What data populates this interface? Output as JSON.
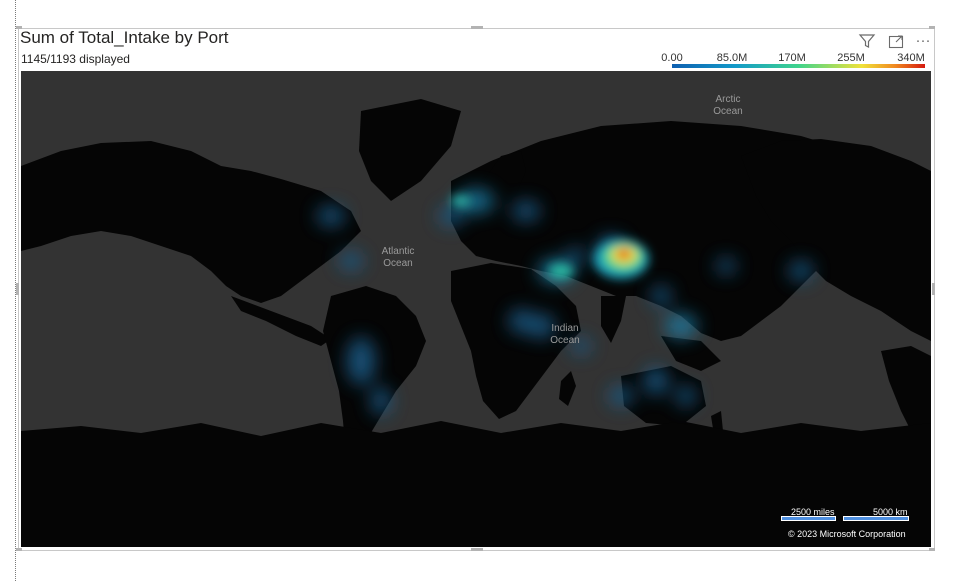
{
  "visual": {
    "title": "Sum of Total_Intake by Port",
    "subtitle": "1145/1193 displayed",
    "header_icons": [
      "filter-icon",
      "focus-mode-icon",
      "more-options-icon"
    ],
    "more_glyph": "···"
  },
  "legend": {
    "labels": [
      "0.00",
      "85.0M",
      "170M",
      "255M",
      "340M"
    ],
    "min": 0,
    "max": 340000000,
    "colors": [
      "#0e5fb0",
      "#139ac9",
      "#3fd48c",
      "#f0e23a",
      "#f08a20",
      "#d51a10"
    ]
  },
  "map": {
    "theme": "dark-grayscale",
    "ocean_labels": {
      "arctic": "Arctic Ocean",
      "atlantic": "Atlantic Ocean",
      "indian": "Indian Ocean"
    },
    "scale": {
      "miles": "2500 miles",
      "km": "5000 km"
    },
    "copyright": "© 2023 Microsoft Corporation"
  },
  "colors": {
    "ocean": "#333333",
    "land": "#050505",
    "border": "#c8c8c8"
  }
}
